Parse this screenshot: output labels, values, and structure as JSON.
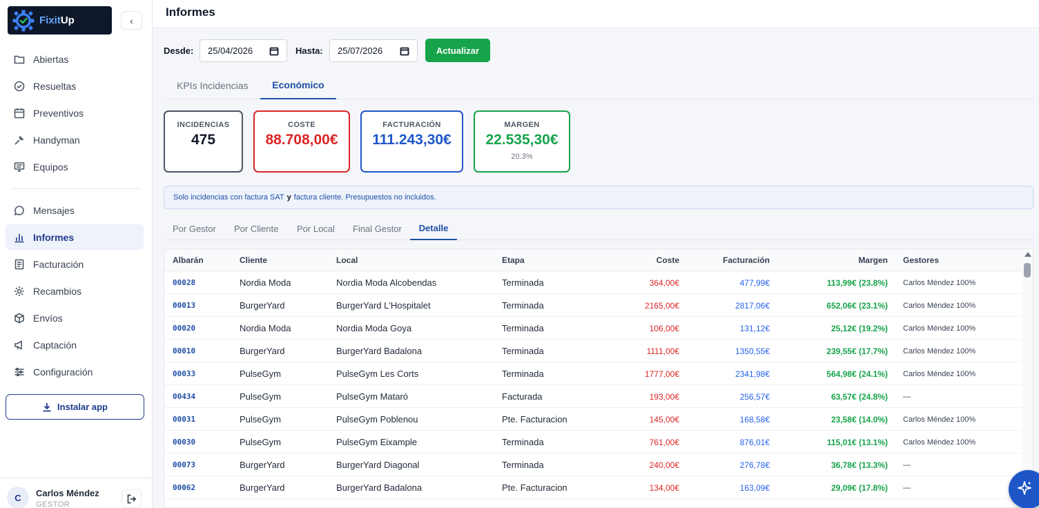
{
  "app": {
    "logo_part1": "Fixit",
    "logo_part2": "Up"
  },
  "sidebar": {
    "items": [
      {
        "label": "Abiertas",
        "icon": "folder-icon"
      },
      {
        "label": "Resueltas",
        "icon": "check-circle-icon"
      },
      {
        "label": "Preventivos",
        "icon": "calendar-icon"
      },
      {
        "label": "Handyman",
        "icon": "wrench-icon"
      },
      {
        "label": "Equipos",
        "icon": "monitor-icon"
      },
      {
        "label": "Mensajes",
        "icon": "message-icon"
      },
      {
        "label": "Informes",
        "icon": "bar-chart-icon",
        "active": true
      },
      {
        "label": "Facturación",
        "icon": "document-icon"
      },
      {
        "label": "Recambios",
        "icon": "gear-icon"
      },
      {
        "label": "Envíos",
        "icon": "box-icon"
      },
      {
        "label": "Captación",
        "icon": "megaphone-icon"
      },
      {
        "label": "Configuración",
        "icon": "sliders-icon"
      }
    ],
    "install_label": "Instalar app"
  },
  "user": {
    "initial": "C",
    "name": "Carlos Méndez",
    "role": "GESTOR"
  },
  "header": {
    "title": "Informes"
  },
  "filters": {
    "from_label": "Desde:",
    "from_value": "25/04/2026",
    "to_label": "Hasta:",
    "to_value": "25/07/2026",
    "update_label": "Actualizar"
  },
  "tabs": [
    {
      "label": "KPIs Incidencias",
      "active": false
    },
    {
      "label": "Económico",
      "active": true
    }
  ],
  "kpis": {
    "incidencias": {
      "label": "INCIDENCIAS",
      "value": "475",
      "color": "#374151"
    },
    "coste": {
      "label": "COSTE",
      "value": "88.708,00€",
      "color": "#dc2626"
    },
    "facturacion": {
      "label": "FACTURACIÓN",
      "value": "111.243,30€",
      "color": "#1e56c8"
    },
    "margen": {
      "label": "MARGEN",
      "value": "22.535,30€",
      "sub": "20.3%",
      "color": "#16a34a"
    }
  },
  "notice": {
    "part1": "Solo incidencias con factura SAT",
    "bold": "y",
    "part2": "factura cliente. Presupuestos no incluidos."
  },
  "subtabs": [
    {
      "label": "Por Gestor",
      "active": false
    },
    {
      "label": "Por Cliente",
      "active": false
    },
    {
      "label": "Por Local",
      "active": false
    },
    {
      "label": "Final Gestor",
      "active": false
    },
    {
      "label": "Detalle",
      "active": true
    }
  ],
  "table": {
    "headers": {
      "albaran": "Albarán",
      "cliente": "Cliente",
      "local": "Local",
      "etapa": "Etapa",
      "coste": "Coste",
      "facturacion": "Facturación",
      "margen": "Margen",
      "gestores": "Gestores"
    },
    "rows": [
      {
        "albaran": "00028",
        "cliente": "Nordia Moda",
        "local": "Nordia Moda Alcobendas",
        "etapa": "Terminada",
        "coste": "364,00€",
        "facturacion": "477,99€",
        "margen": "113,99€ (23.8%)",
        "gestores": "Carlos Méndez 100%"
      },
      {
        "albaran": "00013",
        "cliente": "BurgerYard",
        "local": "BurgerYard L'Hospitalet",
        "etapa": "Terminada",
        "coste": "2165,00€",
        "facturacion": "2817,06€",
        "margen": "652,06€ (23.1%)",
        "gestores": "Carlos Méndez 100%"
      },
      {
        "albaran": "00020",
        "cliente": "Nordia Moda",
        "local": "Nordia Moda Goya",
        "etapa": "Terminada",
        "coste": "106,00€",
        "facturacion": "131,12€",
        "margen": "25,12€ (19.2%)",
        "gestores": "Carlos Méndez 100%"
      },
      {
        "albaran": "00010",
        "cliente": "BurgerYard",
        "local": "BurgerYard Badalona",
        "etapa": "Terminada",
        "coste": "1111,00€",
        "facturacion": "1350,55€",
        "margen": "239,55€ (17.7%)",
        "gestores": "Carlos Méndez 100%"
      },
      {
        "albaran": "00033",
        "cliente": "PulseGym",
        "local": "PulseGym Les Corts",
        "etapa": "Terminada",
        "coste": "1777,00€",
        "facturacion": "2341,98€",
        "margen": "564,98€ (24.1%)",
        "gestores": "Carlos Méndez 100%"
      },
      {
        "albaran": "00434",
        "cliente": "PulseGym",
        "local": "PulseGym Mataró",
        "etapa": "Facturada",
        "coste": "193,00€",
        "facturacion": "256,57€",
        "margen": "63,57€ (24.8%)",
        "gestores": "—"
      },
      {
        "albaran": "00031",
        "cliente": "PulseGym",
        "local": "PulseGym Poblenou",
        "etapa": "Pte. Facturacion",
        "coste": "145,00€",
        "facturacion": "168,58€",
        "margen": "23,58€ (14.0%)",
        "gestores": "Carlos Méndez 100%"
      },
      {
        "albaran": "00030",
        "cliente": "PulseGym",
        "local": "PulseGym Eixample",
        "etapa": "Terminada",
        "coste": "761,00€",
        "facturacion": "876,01€",
        "margen": "115,01€ (13.1%)",
        "gestores": "Carlos Méndez 100%"
      },
      {
        "albaran": "00073",
        "cliente": "BurgerYard",
        "local": "BurgerYard Diagonal",
        "etapa": "Terminada",
        "coste": "240,00€",
        "facturacion": "276,78€",
        "margen": "36,78€ (13.3%)",
        "gestores": "—"
      },
      {
        "albaran": "00062",
        "cliente": "BurgerYard",
        "local": "BurgerYard Badalona",
        "etapa": "Pte. Facturacion",
        "coste": "134,00€",
        "facturacion": "163,09€",
        "margen": "29,09€ (17.8%)",
        "gestores": "—"
      }
    ]
  }
}
